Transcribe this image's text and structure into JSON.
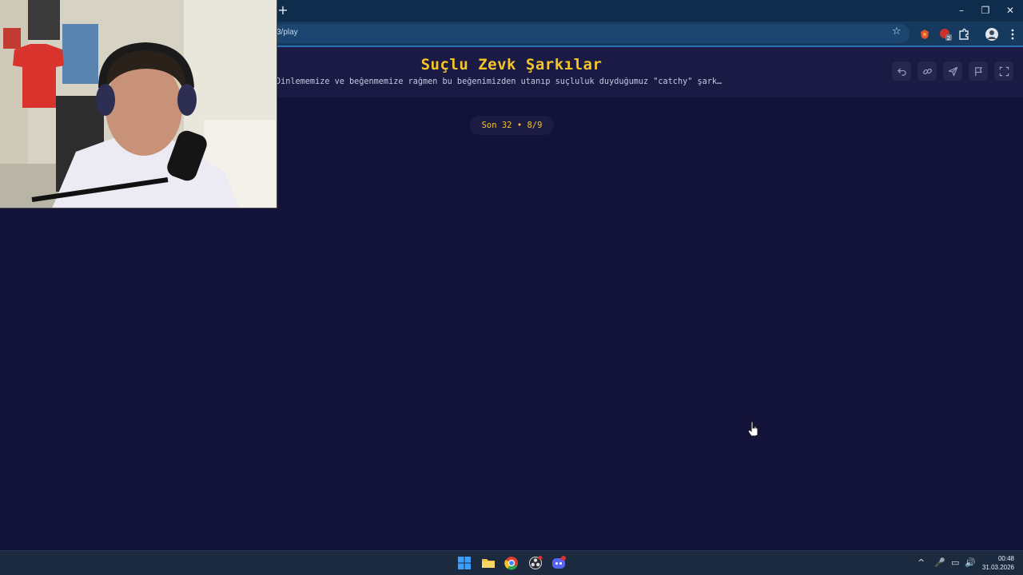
{
  "browser": {
    "new_tab_glyph": "+",
    "url": "3/play",
    "window_controls": {
      "minimize": "–",
      "maximize": "❐",
      "close": "✕"
    },
    "toolbar_icons": [
      "star-icon",
      "extension-red-icon",
      "extension-badge-icon",
      "puzzle-icon",
      "profile-icon",
      "menu-icon"
    ],
    "extension_badge": "2"
  },
  "app": {
    "title": "Suçlu Zevk Şarkılar",
    "subtitle": "Dinlememize ve beğenmemize rağmen bu beğenimizden utanıp suçluluk duyduğumuz \"catchy\" şark…",
    "header_buttons": [
      "undo-icon",
      "link-icon",
      "send-icon",
      "flag-icon",
      "fullscreen-icon"
    ],
    "progress_label": "Son 32 • 8/9",
    "accent_color": "#f5c527",
    "background_color": "#13133a"
  },
  "taskbar": {
    "apps": [
      "windows-start-icon",
      "file-explorer-icon",
      "chrome-icon",
      "obs-icon",
      "discord-icon"
    ],
    "tray": {
      "chevron": "^",
      "mic": "🎤",
      "network": "▭",
      "volume": "🔊"
    },
    "time": "00:48",
    "date": "31.03.2026"
  }
}
